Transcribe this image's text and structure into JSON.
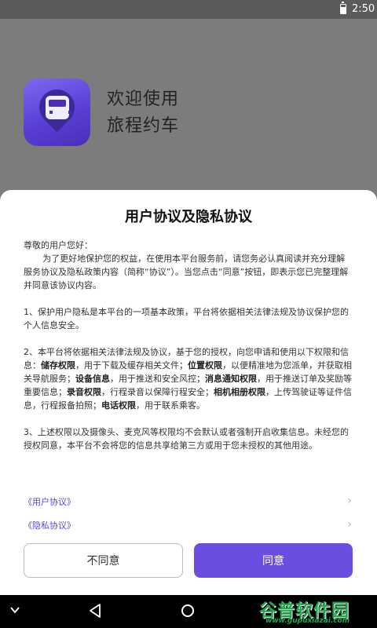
{
  "status_bar": {
    "time": "2:50"
  },
  "welcome": {
    "line1": "欢迎使用",
    "line2": "旅程约车"
  },
  "dialog": {
    "title": "用户协议及隐私协议",
    "greeting": "尊敬的用户您好：",
    "para1": "为了更好地保护您的权益，在使用本平台服务前，请您务必认真阅读并充分理解服务协议及隐私政策内容（简称“协议”）。当您点击“同意”按钮，即表示您已完整理解并同意该协议内容。",
    "para2": "1、保护用户隐私是本平台的一项基本政策，平台将依据相关法律法规及协议保护您的个人信息安全。",
    "para3": {
      "t1": "2、本平台将依据相关法律法规及协议，基于您的授权，向您申请和使用以下权限和信息：",
      "b1": "储存权限",
      "t2": "，用于下载及缓存相关文件；",
      "b2": "位置权限",
      "t3": "，以便精准地为您派单，并获取相关导航服务；",
      "b3": "设备信息",
      "t4": "，用于推送和安全风控；",
      "b4": "消息通知权限",
      "t5": "，用于推送订单及奖励等重要信息；",
      "b5": "录音权限",
      "t6": "，行程录音以保障行程安全；",
      "b6": "相机相册权限",
      "t7": "，上传驾驶证等证件信息，行程报备拍照；",
      "b7": "电话权限",
      "t8": "，用于联系乘客。"
    },
    "para4": "3、上述权限以及摄像头、麦克风等权限均不会默认或者强制开启收集信息。未经您的授权同意，本平台不会将您的信息共享给第三方或用于您未授权的其他用途。",
    "links": [
      {
        "label": "《用户协议》"
      },
      {
        "label": "《隐私协议》"
      }
    ],
    "disagree_label": "不同意",
    "agree_label": "同意"
  },
  "watermark": {
    "logo": "谷普软件园",
    "url": "www.gupuxiazai.com"
  },
  "colors": {
    "accent": "#6b4ee0",
    "link": "#5b46d4",
    "backdrop": "#7c7c7c"
  }
}
